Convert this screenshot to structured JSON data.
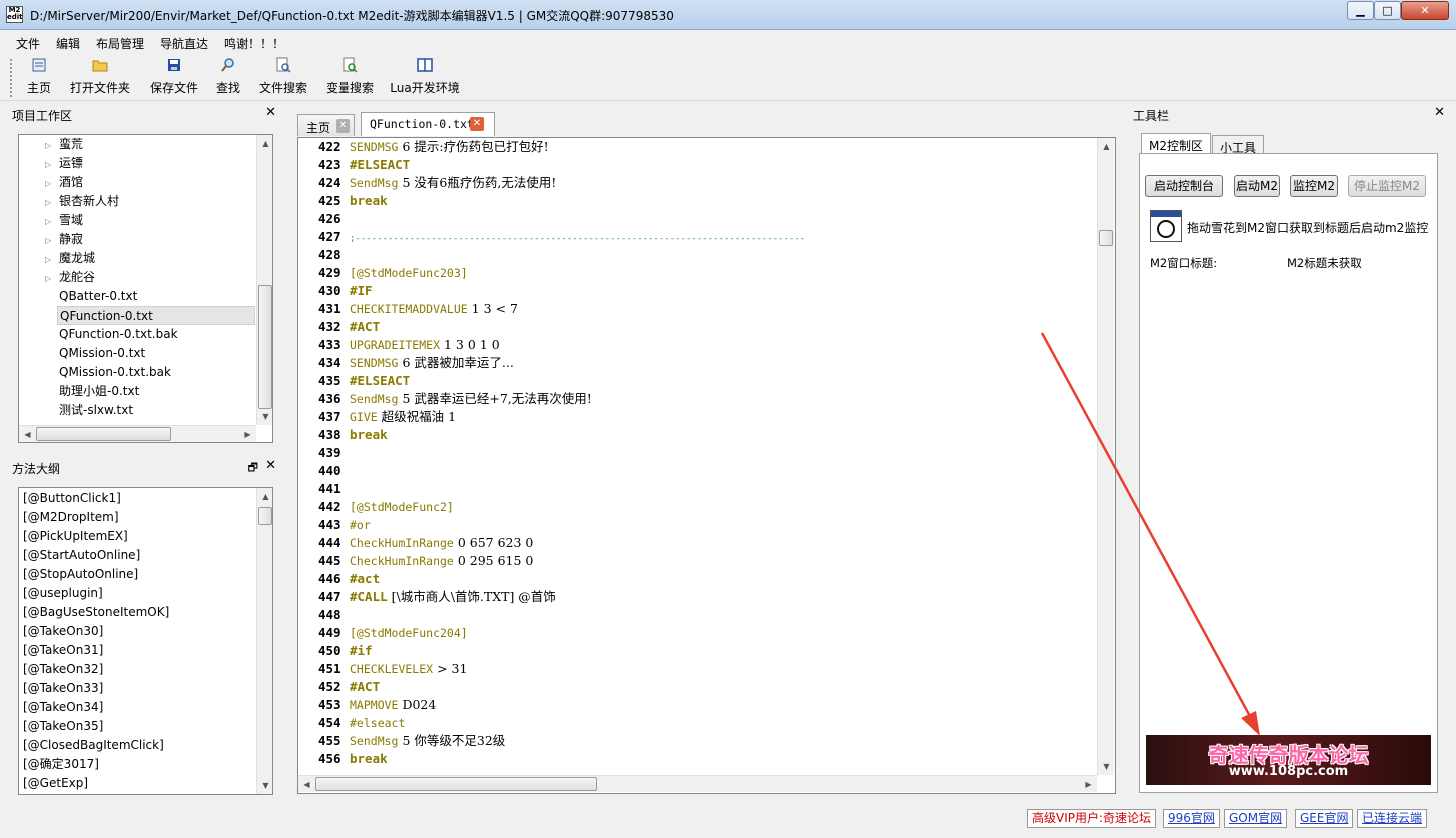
{
  "window": {
    "title": "D:/MirServer/Mir200/Envir/Market_Def/QFunction-0.txt  M2edit-游戏脚本编辑器V1.5 | GM交流QQ群:907798530",
    "icon_text": "M2 edit",
    "min_label": "▁",
    "max_label": "□",
    "close_label": "✕"
  },
  "menu": [
    "文件",
    "编辑",
    "布局管理",
    "导航直达",
    "鸣谢！！！"
  ],
  "toolbar": [
    {
      "label": "主页",
      "icon": "home-icon"
    },
    {
      "label": "打开文件夹",
      "icon": "folder-icon"
    },
    {
      "label": "保存文件",
      "icon": "save-icon"
    },
    {
      "label": "查找",
      "icon": "search-icon"
    },
    {
      "label": "文件搜索",
      "icon": "file-search-icon"
    },
    {
      "label": "变量搜索",
      "icon": "variable-search-icon"
    },
    {
      "label": "Lua开发环境",
      "icon": "book-icon"
    }
  ],
  "project_panel": {
    "title": "项目工作区",
    "close": "✕",
    "folders": [
      "蛮荒",
      "运镖",
      "酒馆",
      "银杏新人村",
      "雪域",
      "静寂",
      "魔龙城",
      "龙舵谷"
    ],
    "files": [
      "QBatter-0.txt",
      "QFunction-0.txt",
      "QFunction-0.txt.bak",
      "QMission-0.txt",
      "QMission-0.txt.bak",
      "助理小姐-0.txt",
      "测试-slxw.txt"
    ],
    "selected": "QFunction-0.txt"
  },
  "outline_panel": {
    "title": "方法大纲",
    "float": "🗗",
    "close": "✕",
    "items": [
      "[@ButtonClick1]",
      "[@M2DropItem]",
      "[@PickUpItemEX]",
      "[@StartAutoOnline]",
      "[@StopAutoOnline]",
      "[@useplugin]",
      "[@BagUseStoneItemOK]",
      "[@TakeOn30]",
      "[@TakeOn31]",
      "[@TakeOn32]",
      "[@TakeOn33]",
      "[@TakeOn34]",
      "[@TakeOn35]",
      "[@ClosedBagItemClick]",
      "[@确定3017]",
      "[@GetExp]"
    ]
  },
  "editor": {
    "tabs": [
      {
        "label": "主页",
        "close": "✕"
      },
      {
        "label": "QFunction-0.txt",
        "close": "✕"
      }
    ],
    "lines": [
      {
        "n": "422",
        "parts": [
          [
            "cmd",
            "SENDMSG"
          ],
          [
            "txt",
            " 6 提示:疗伤药包已打包好!"
          ]
        ]
      },
      {
        "n": "423",
        "parts": [
          [
            "ctl",
            "#ELSEACT"
          ]
        ]
      },
      {
        "n": "424",
        "parts": [
          [
            "cmd",
            "SendMsg"
          ],
          [
            "txt",
            " 5 没有6瓶疗伤药,无法使用!"
          ]
        ]
      },
      {
        "n": "425",
        "parts": [
          [
            "ctl",
            "break"
          ]
        ]
      },
      {
        "n": "426",
        "parts": []
      },
      {
        "n": "427",
        "parts": [
          [
            "sep",
            ";-----------------------------------------------------------------------------------"
          ]
        ]
      },
      {
        "n": "428",
        "parts": []
      },
      {
        "n": "429",
        "parts": [
          [
            "lbl",
            "[@StdModeFunc203]"
          ]
        ]
      },
      {
        "n": "430",
        "parts": [
          [
            "ctl",
            "#IF"
          ]
        ]
      },
      {
        "n": "431",
        "parts": [
          [
            "cmd",
            "CHECKITEMADDVALUE"
          ],
          [
            "txt",
            " 1 3 < 7"
          ]
        ]
      },
      {
        "n": "432",
        "parts": [
          [
            "ctl",
            "#ACT"
          ]
        ]
      },
      {
        "n": "433",
        "parts": [
          [
            "cmd",
            "UPGRADEITEMEX"
          ],
          [
            "txt",
            " 1 3 0 1 0"
          ]
        ]
      },
      {
        "n": "434",
        "parts": [
          [
            "cmd",
            "SENDMSG"
          ],
          [
            "txt",
            " 6 武器被加幸运了..."
          ]
        ]
      },
      {
        "n": "435",
        "parts": [
          [
            "ctl",
            "#ELSEACT"
          ]
        ]
      },
      {
        "n": "436",
        "parts": [
          [
            "cmd",
            "SendMsg"
          ],
          [
            "txt",
            " 5 武器幸运已经+7,无法再次使用!"
          ]
        ]
      },
      {
        "n": "437",
        "parts": [
          [
            "cmd",
            "GIVE"
          ],
          [
            "txt",
            " 超级祝福油 1"
          ]
        ]
      },
      {
        "n": "438",
        "parts": [
          [
            "ctl",
            "break"
          ]
        ]
      },
      {
        "n": "439",
        "parts": []
      },
      {
        "n": "440",
        "parts": []
      },
      {
        "n": "441",
        "parts": []
      },
      {
        "n": "442",
        "parts": [
          [
            "lbl",
            "[@StdModeFunc2]"
          ]
        ]
      },
      {
        "n": "443",
        "parts": [
          [
            "cmd",
            "#or"
          ]
        ]
      },
      {
        "n": "444",
        "parts": [
          [
            "cmd",
            "CheckHumInRange"
          ],
          [
            "txt",
            " 0 657 623 0"
          ]
        ]
      },
      {
        "n": "445",
        "parts": [
          [
            "cmd",
            "CheckHumInRange"
          ],
          [
            "txt",
            " 0 295 615 0"
          ]
        ]
      },
      {
        "n": "446",
        "parts": [
          [
            "ctl",
            "#act"
          ]
        ]
      },
      {
        "n": "447",
        "parts": [
          [
            "ctl",
            "#CALL"
          ],
          [
            "txt",
            " [\\城市商人\\首饰.TXT] @首饰"
          ]
        ]
      },
      {
        "n": "448",
        "parts": []
      },
      {
        "n": "449",
        "parts": [
          [
            "lbl",
            "[@StdModeFunc204]"
          ]
        ]
      },
      {
        "n": "450",
        "parts": [
          [
            "ctl",
            "#if"
          ]
        ]
      },
      {
        "n": "451",
        "parts": [
          [
            "cmd",
            "CHECKLEVELEX"
          ],
          [
            "txt",
            " > 31"
          ]
        ]
      },
      {
        "n": "452",
        "parts": [
          [
            "ctl",
            "#ACT"
          ]
        ]
      },
      {
        "n": "453",
        "parts": [
          [
            "cmd",
            "MAPMOVE"
          ],
          [
            "txt",
            " D024"
          ]
        ]
      },
      {
        "n": "454",
        "parts": [
          [
            "cmd",
            "#elseact"
          ]
        ]
      },
      {
        "n": "455",
        "parts": [
          [
            "cmd",
            "SendMsg"
          ],
          [
            "txt",
            " 5 你等级不足32级"
          ]
        ]
      },
      {
        "n": "456",
        "parts": [
          [
            "ctl",
            "break"
          ]
        ]
      }
    ]
  },
  "tool_panel": {
    "title": "工具栏",
    "close": "✕",
    "tabs": [
      "M2控制区",
      "小工具"
    ],
    "buttons": [
      "启动控制台",
      "启动M2",
      "监控M2",
      "停止监控M2"
    ],
    "finder_hint": "拖动雪花到M2窗口获取到标题后启动m2监控",
    "title_label": "M2窗口标题:",
    "title_value": "M2标题未获取",
    "banner_title": "奇速传奇版本论坛",
    "banner_url": "www.108pc.com"
  },
  "status": {
    "links": [
      "高级VIP用户:奇速论坛",
      "996官网",
      "GOM官网",
      "GEE官网",
      "已连接云端"
    ]
  },
  "colors": {
    "keyword": "#8a7a00",
    "separator": "#2e9b2e",
    "vip": "#cc0000",
    "link": "#1a3dc2",
    "annotation_arrow": "#e8402e"
  }
}
